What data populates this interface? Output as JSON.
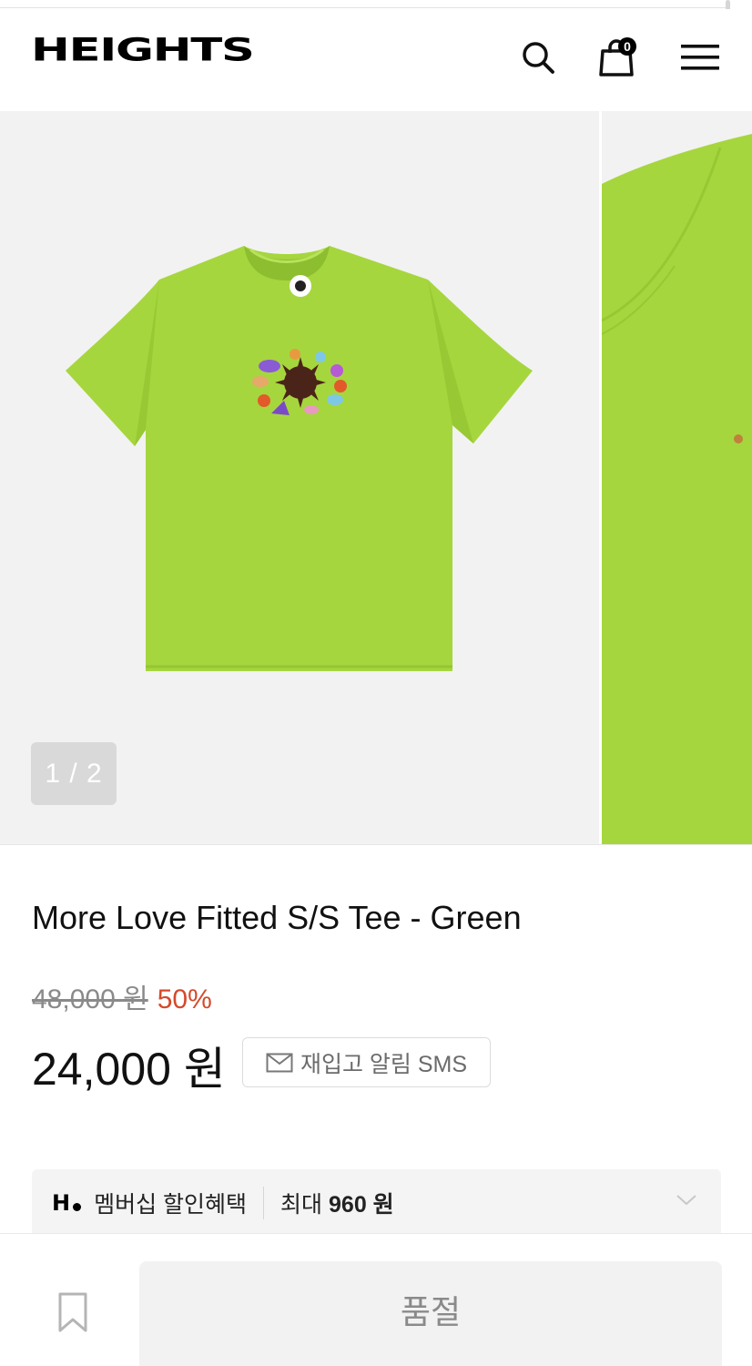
{
  "header": {
    "logo": "HEIGHTS",
    "cart_count": "0"
  },
  "icons": {
    "search": "search-icon",
    "cart": "shopping-bag-icon",
    "menu": "hamburger-menu-icon",
    "mail": "mail-icon",
    "chevron": "chevron-down-icon",
    "bookmark": "bookmark-icon"
  },
  "gallery": {
    "counter": "1 / 2",
    "current": 1,
    "total": 2
  },
  "product": {
    "title": "More Love Fitted S/S Tee - Green",
    "original_price": "48,000 원",
    "discount": "50%",
    "sale_price": "24,000 원",
    "restock_label": "재입고 알림 SMS"
  },
  "membership": {
    "logo": "H",
    "label": "멤버십 할인혜택",
    "max_prefix": "최대",
    "max_value": "960 원"
  },
  "bottom": {
    "soldout_label": "품절"
  },
  "colors": {
    "accent_discount": "#d4492a",
    "shirt_green": "#a6d63e",
    "badge_bg": "#000000"
  }
}
